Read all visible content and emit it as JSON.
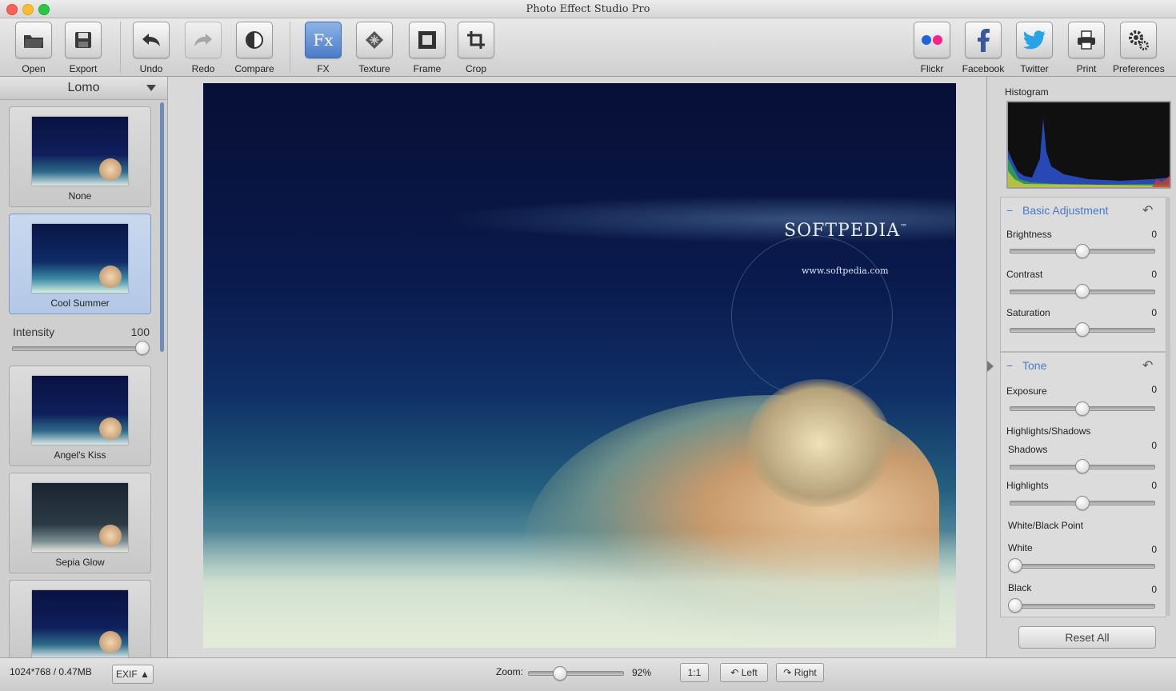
{
  "window": {
    "title": "Photo Effect Studio Pro"
  },
  "toolbar": {
    "open": "Open",
    "export": "Export",
    "undo": "Undo",
    "redo": "Redo",
    "compare": "Compare",
    "fx": "FX",
    "fx_icon_text": "Fx",
    "texture": "Texture",
    "frame": "Frame",
    "crop": "Crop",
    "flickr": "Flickr",
    "facebook": "Facebook",
    "twitter": "Twitter",
    "print": "Print",
    "preferences": "Preferences"
  },
  "left_panel": {
    "category": "Lomo",
    "intensity_label": "Intensity",
    "intensity_value": "100",
    "intensity_fraction": 1.0,
    "presets": [
      {
        "label": "None",
        "selected": false
      },
      {
        "label": "Cool Summer",
        "selected": true
      },
      {
        "label": "Angel's Kiss",
        "selected": false
      },
      {
        "label": "Sepia Glow",
        "selected": false
      },
      {
        "label": "",
        "selected": false
      }
    ]
  },
  "photo": {
    "brand_text": "SOFTPEDIA",
    "brand_mark": "™",
    "url_text": "www.softpedia.com"
  },
  "right_panel": {
    "histogram_label": "Histogram",
    "basic": {
      "title": "Basic Adjustment",
      "brightness_label": "Brightness",
      "brightness_value": "0",
      "contrast_label": "Contrast",
      "contrast_value": "0",
      "saturation_label": "Saturation",
      "saturation_value": "0"
    },
    "tone": {
      "title": "Tone",
      "exposure_label": "Exposure",
      "exposure_value": "0",
      "hs_label": "Highlights/Shadows",
      "shadows_label": "Shadows",
      "shadows_value": "0",
      "highlights_label": "Highlights",
      "highlights_value": "0",
      "wb_label": "White/Black Point",
      "white_label": "White",
      "white_value": "0",
      "black_label": "Black",
      "black_value": "0"
    },
    "reset_all": "Reset All"
  },
  "status": {
    "image_info": "1024*768 / 0.47MB",
    "exif": "EXIF ▲",
    "zoom_label": "Zoom:",
    "zoom_value": "92%",
    "zoom_fraction": 0.3,
    "one_to_one": "1:1",
    "rotate_left": "Left",
    "rotate_right": "Right"
  },
  "colors": {
    "accent": "#4a78c9",
    "fx_active": "#4a7bc8"
  }
}
